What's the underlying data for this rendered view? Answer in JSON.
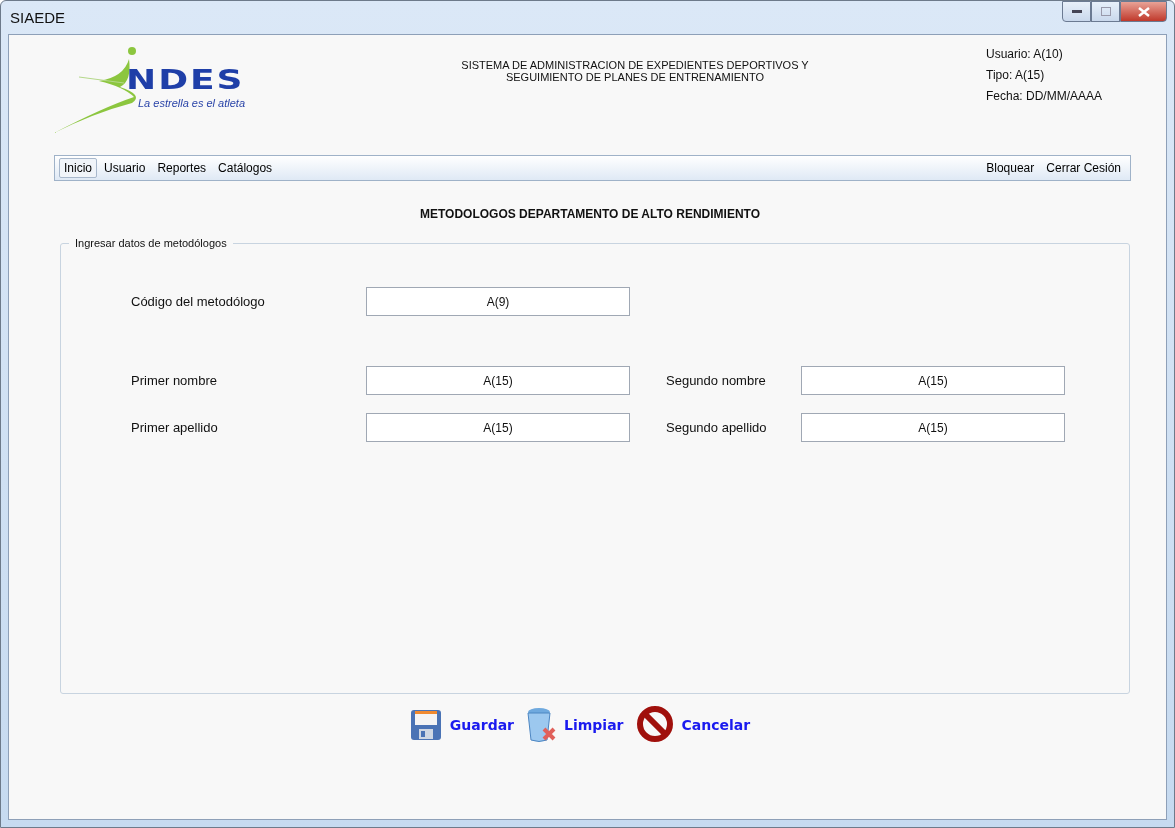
{
  "window": {
    "title": "SIAEDE"
  },
  "logo": {
    "name": "NDES",
    "tagline": "La estrella es el atleta"
  },
  "header": {
    "title_lines": [
      "SISTEMA DE ADMINISTRACION DE EXPEDIENTES DEPORTIVOS Y",
      "SEGUIMIENTO DE PLANES DE ENTRENAMIENTO"
    ],
    "user_info": [
      "Usuario: A(10)",
      "Tipo:  A(15)",
      "Fecha: DD/MM/AAAA"
    ]
  },
  "menu": {
    "left": [
      {
        "label": "Inicio",
        "selected": true
      },
      {
        "label": "Usuario",
        "selected": false
      },
      {
        "label": "Reportes",
        "selected": false
      },
      {
        "label": "Catálogos",
        "selected": false
      }
    ],
    "right": [
      {
        "label": "Bloquear",
        "selected": false
      },
      {
        "label": "Cerrar Cesión",
        "selected": false
      }
    ]
  },
  "page_title": "METODOLOGOS DEPARTAMENTO DE ALTO RENDIMIENTO",
  "form": {
    "legend": "Ingresar datos de metodólogos",
    "code": {
      "label": "Código del metodólogo",
      "value": "A(9)"
    },
    "fields": [
      {
        "label": "Primer nombre",
        "value": "A(15)"
      },
      {
        "label": "Segundo nombre",
        "value": "A(15)"
      },
      {
        "label": "Primer apellido",
        "value": "A(15)"
      },
      {
        "label": "Segundo apellido",
        "value": "A(15)"
      }
    ]
  },
  "actions": [
    {
      "kind": "save",
      "label": "Guardar"
    },
    {
      "kind": "clear",
      "label": "Limpiar"
    },
    {
      "kind": "cancel",
      "label": "Cancelar"
    }
  ]
}
